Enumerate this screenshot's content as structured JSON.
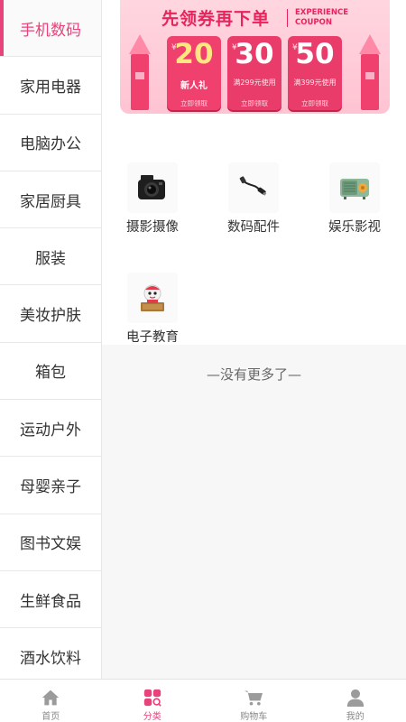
{
  "sidebar": {
    "items": [
      {
        "label": "手机数码",
        "active": true
      },
      {
        "label": "家用电器"
      },
      {
        "label": "电脑办公"
      },
      {
        "label": "家居厨具"
      },
      {
        "label": "服装"
      },
      {
        "label": "美妆护肤"
      },
      {
        "label": "箱包"
      },
      {
        "label": "运动户外"
      },
      {
        "label": "母婴亲子"
      },
      {
        "label": "图书文娱"
      },
      {
        "label": "生鲜食品"
      },
      {
        "label": "酒水饮料"
      }
    ]
  },
  "banner": {
    "title": "先领券再下单",
    "subtitle_line1": "EXPERIENCE",
    "subtitle_line2": "COUPON",
    "coupons": [
      {
        "currency": "¥",
        "amount": "20",
        "note": "新人礼",
        "action": "立即领取"
      },
      {
        "currency": "¥",
        "amount": "30",
        "note": "满299元使用",
        "action": "立即领取"
      },
      {
        "currency": "¥",
        "amount": "50",
        "note": "满399元使用",
        "action": "立即领取"
      }
    ]
  },
  "categories": [
    {
      "label": "摄影摄像",
      "icon": "camera-icon"
    },
    {
      "label": "数码配件",
      "icon": "cable-icon"
    },
    {
      "label": "娱乐影视",
      "icon": "radio-icon"
    },
    {
      "label": "电子教育",
      "icon": "education-robot-icon"
    }
  ],
  "no_more_text": "—没有更多了—",
  "tabbar": {
    "tabs": [
      {
        "label": "首页",
        "icon": "home-icon"
      },
      {
        "label": "分类",
        "icon": "category-icon",
        "active": true
      },
      {
        "label": "购物车",
        "icon": "cart-icon"
      },
      {
        "label": "我的",
        "icon": "user-icon"
      }
    ]
  },
  "colors": {
    "accent": "#e8437b",
    "banner_red": "#ea3c6a",
    "text": "#333333",
    "muted": "#888888"
  }
}
